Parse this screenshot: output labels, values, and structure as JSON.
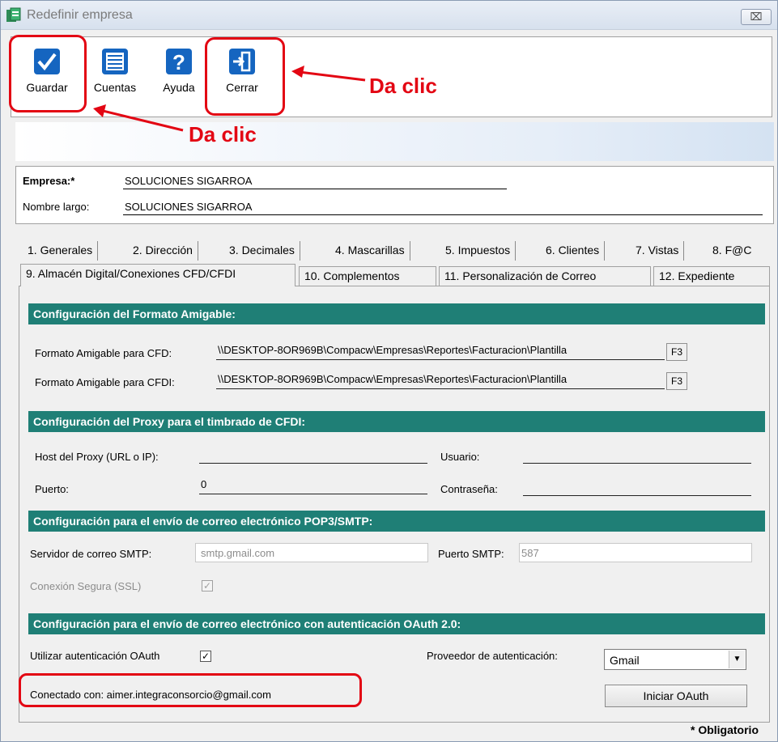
{
  "window": {
    "title": "Redefinir empresa",
    "close_label": "⌧"
  },
  "toolbar": {
    "buttons": [
      {
        "label": "Guardar"
      },
      {
        "label": "Cuentas"
      },
      {
        "label": "Ayuda"
      },
      {
        "label": "Cerrar"
      }
    ]
  },
  "annotations": {
    "cerrar_hint": "Da clic",
    "guardar_hint": "Da clic",
    "color": "#e30613"
  },
  "company": {
    "empresa_label": "Empresa:*",
    "empresa_value": "SOLUCIONES SIGARROA",
    "nombre_label": "Nombre largo:",
    "nombre_value": "SOLUCIONES SIGARROA"
  },
  "tabs": {
    "row1": [
      "1. Generales",
      "2. Dirección",
      "3. Decimales",
      "4. Mascarillas",
      "5. Impuestos",
      "6. Clientes",
      "7. Vistas",
      "8. F@C"
    ],
    "row2": [
      "9. Almacén Digital/Conexiones CFD/CFDI",
      "10. Complementos",
      "11. Personalización de Correo",
      "12. Expediente"
    ]
  },
  "formato": {
    "header": "Configuración del Formato Amigable:",
    "cfd_label": "Formato Amigable para CFD:",
    "cfd_value": "\\\\DESKTOP-8OR969B\\Compacw\\Empresas\\Reportes\\Facturacion\\Plantilla",
    "cfdi_label": "Formato Amigable para CFDI:",
    "cfdi_value": "\\\\DESKTOP-8OR969B\\Compacw\\Empresas\\Reportes\\Facturacion\\Plantilla",
    "f3_label": "F3"
  },
  "proxy": {
    "header": "Configuración del Proxy para el timbrado de CFDI:",
    "host_label": "Host del Proxy (URL o IP):",
    "host_value": "",
    "usuario_label": "Usuario:",
    "usuario_value": "",
    "puerto_label": "Puerto:",
    "puerto_value": "0",
    "contrasena_label": "Contraseña:",
    "contrasena_value": ""
  },
  "smtp": {
    "header": "Configuración para el envío de correo electrónico POP3/SMTP:",
    "server_label": "Servidor de correo SMTP:",
    "server_value": "smtp.gmail.com",
    "port_label": "Puerto SMTP:",
    "port_value": "587",
    "ssl_label": "Conexión Segura (SSL)",
    "ssl_checked": "✓"
  },
  "oauth": {
    "header": "Configuración para el envío de correo electrónico con autenticación OAuth 2.0:",
    "use_label": "Utilizar autenticación OAuth",
    "use_checked": "✓",
    "provider_label": "Proveedor de autenticación:",
    "provider_value": "Gmail",
    "connected_label": "Conectado con: aimer.integraconsorcio@gmail.com",
    "start_button": "Iniciar OAuth"
  },
  "footer": {
    "required_note": "* Obligatorio"
  },
  "colors": {
    "section_bar": "#1f7f76",
    "icon_blue": "#1565c0"
  }
}
